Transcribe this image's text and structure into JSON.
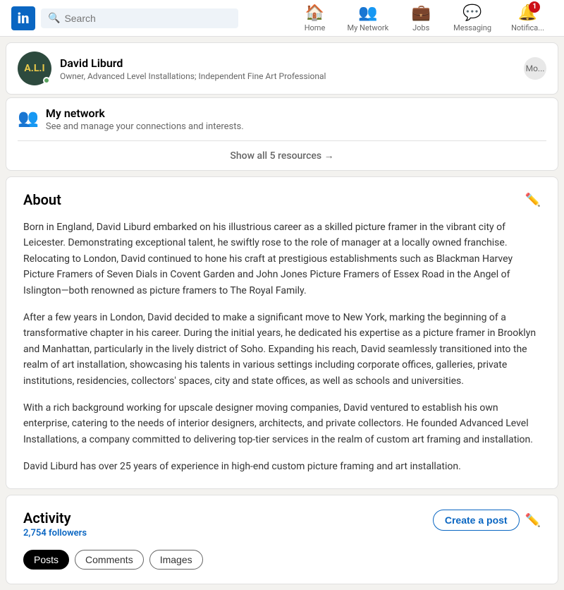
{
  "nav": {
    "logo": "in",
    "search_placeholder": "Search",
    "items": [
      {
        "label": "Home",
        "icon": "🏠",
        "badge": null,
        "active": false
      },
      {
        "label": "My Network",
        "icon": "👥",
        "badge": null,
        "active": false
      },
      {
        "label": "Jobs",
        "icon": "💼",
        "badge": null,
        "active": false
      },
      {
        "label": "Messaging",
        "icon": "💬",
        "badge": null,
        "active": false
      },
      {
        "label": "Notifica...",
        "icon": "🔔",
        "badge": "1",
        "active": false
      }
    ]
  },
  "profile": {
    "initials": "A.L.I",
    "name": "David Liburd",
    "title": "Owner, Advanced Level Installations; Independent Fine Art Professional",
    "more_label": "Mo..."
  },
  "my_network": {
    "title": "My network",
    "subtitle": "See and manage your connections and interests.",
    "show_all_label": "Show all 5 resources →"
  },
  "about": {
    "title": "About",
    "paragraphs": [
      "Born in England, David Liburd embarked on his illustrious career as a skilled picture framer in the vibrant city of Leicester. Demonstrating exceptional talent, he swiftly rose to the role of manager at a locally owned franchise. Relocating to London, David continued to hone his craft at prestigious establishments such as Blackman Harvey Picture Framers of Seven Dials in Covent Garden and John Jones Picture Framers of Essex Road in the Angel of Islington—both renowned as picture framers to The Royal Family.",
      "After a few years in London, David decided to make a significant move to New York, marking the beginning of a transformative chapter in his career. During the initial years, he dedicated his expertise as a picture framer in Brooklyn and Manhattan, particularly in the lively district of Soho. Expanding his reach, David seamlessly transitioned into the realm of art installation, showcasing his talents in various settings including corporate offices, galleries, private institutions, residencies, collectors' spaces, city and state offices, as well as schools and universities.",
      "With a rich background working for upscale designer moving companies, David ventured to establish his own enterprise, catering to the needs of interior designers, architects, and private collectors. He founded Advanced Level Installations, a company committed to delivering top-tier services in the realm of custom art framing and installation.",
      "David Liburd has over 25 years of experience in high-end custom picture framing and art installation."
    ]
  },
  "activity": {
    "title": "Activity",
    "followers": "2,754 followers",
    "create_post_label": "Create a post",
    "tabs": [
      {
        "label": "Posts",
        "active": true
      },
      {
        "label": "Comments",
        "active": false
      },
      {
        "label": "Images",
        "active": false
      }
    ]
  }
}
